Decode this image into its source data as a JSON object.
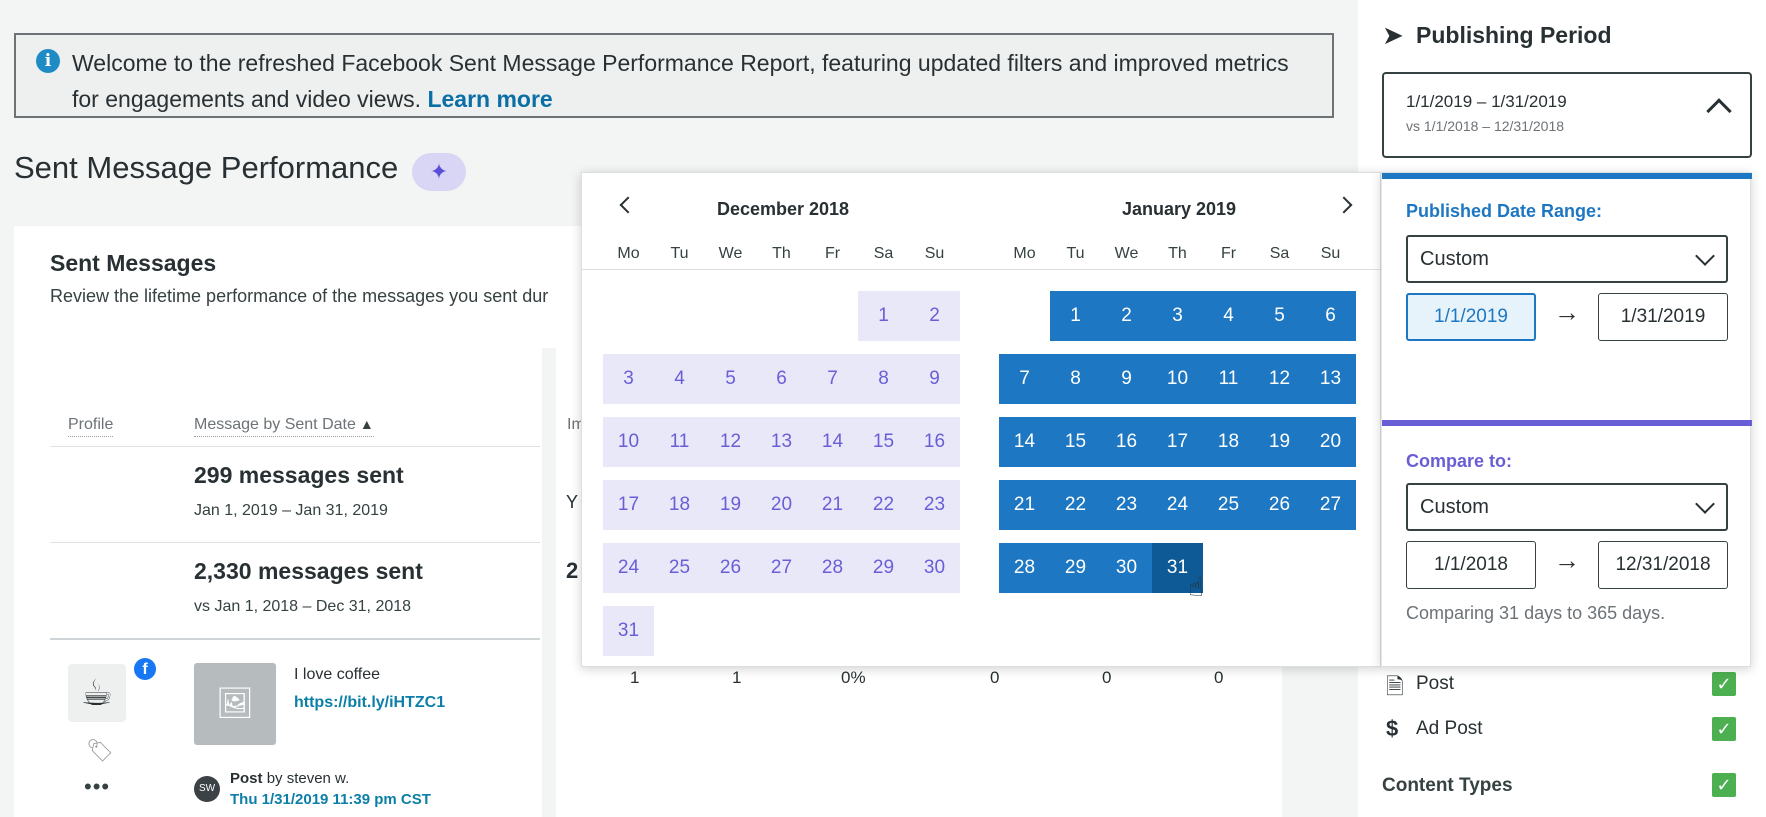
{
  "banner": {
    "text": "Welcome to the refreshed Facebook Sent Message Performance Report, featuring updated filters and improved metrics for engagements and video views.",
    "link": "Learn more"
  },
  "page": {
    "title": "Sent Message Performance",
    "ai_icon": "sparkle-icon"
  },
  "card": {
    "heading": "Sent Messages",
    "subtitle": "Review the lifetime performance of the messages you sent dur",
    "columns": {
      "profile": "Profile",
      "message_by_sent_date": "Message by Sent Date",
      "impressions_partial": "Imp"
    },
    "summary": [
      {
        "title": "299 messages sent",
        "sub": "Jan 1, 2019 – Jan 31, 2019",
        "peek": "Y"
      },
      {
        "title": "2,330 messages sent",
        "sub": "vs Jan 1, 2018 – Dec 31, 2018",
        "peek": "2"
      }
    ],
    "message": {
      "text": "I love coffee",
      "link": "https://bit.ly/iHTZC1",
      "author_initials": "SW",
      "post_type": "Post",
      "author": "by steven w.",
      "date": "Thu 1/31/2019 11:39 pm CST",
      "cells": [
        "1",
        "1",
        "0%",
        "0",
        "0",
        "0"
      ]
    }
  },
  "publishing_period": {
    "title": "Publishing Period",
    "range": "1/1/2019 – 1/31/2019",
    "compare": "vs 1/1/2018 – 12/31/2018"
  },
  "calendar": {
    "left_month": "December 2018",
    "right_month": "January 2019",
    "weekdays": [
      "Mo",
      "Tu",
      "We",
      "Th",
      "Fr",
      "Sa",
      "Su"
    ],
    "selected_day": "31"
  },
  "range_panel": {
    "published_label": "Published Date Range:",
    "published_select": "Custom",
    "start_date": "1/1/2019",
    "end_date": "1/31/2019",
    "compare_label": "Compare to:",
    "compare_select": "Custom",
    "compare_start": "1/1/2018",
    "compare_end": "12/31/2018",
    "compare_note": "Comparing 31 days to 365 days."
  },
  "filters": {
    "post": "Post",
    "ad_post": "Ad Post",
    "content_types": "Content Types"
  },
  "colors": {
    "accent_blue": "#1e77c2",
    "accent_purple": "#6a5ed6",
    "check_green": "#4caf50"
  }
}
